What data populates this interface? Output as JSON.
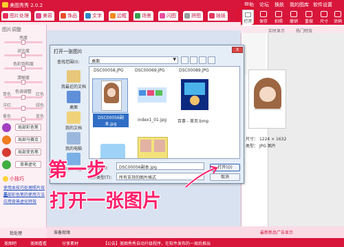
{
  "app": {
    "title": "美图秀秀 2.0.2"
  },
  "window_controls": {
    "items": [
      "帮助",
      "论坛",
      "换肤",
      "我的图库",
      "软件设置"
    ]
  },
  "tabs": [
    {
      "label": "图片处理",
      "color": "#e62e59"
    },
    {
      "label": "美容",
      "color": "#e24a86"
    },
    {
      "label": "饰品",
      "color": "#e64e2a"
    },
    {
      "label": "文字",
      "color": "#2e86c8"
    },
    {
      "label": "边框",
      "color": "#f28a1e"
    },
    {
      "label": "场景",
      "color": "#3aa04c"
    },
    {
      "label": "闪图",
      "color": "#e84e9e"
    },
    {
      "label": "拼图",
      "color": "#999999"
    },
    {
      "label": "娃娃",
      "color": "#e2365d"
    }
  ],
  "toolbar": {
    "open": "打开",
    "buttons": [
      "保存",
      "拍照",
      "撤销",
      "重做",
      "尺寸",
      "涂鸦"
    ]
  },
  "left_panel": {
    "section_title": "图片调整",
    "sliders": [
      {
        "label": "亮度",
        "value": 0.5
      },
      {
        "label": "对比度",
        "value": 0.5
      },
      {
        "label": "色彩饱和度",
        "value": 0.5
      },
      {
        "label": "清晰度",
        "value": 0.5
      }
    ],
    "color_section_title": "色调调整",
    "color_sliders": [
      {
        "left": "青色",
        "right": "红色",
        "value": 0.5
      },
      {
        "left": "洋红",
        "right": "绿色",
        "value": 0.5
      },
      {
        "left": "黄色",
        "right": "蓝色",
        "value": 0.5
      }
    ],
    "effects": [
      {
        "label": "局部彩色笔",
        "color": "#a13fbf"
      },
      {
        "label": "局部马赛克",
        "color": "#f07d21"
      },
      {
        "label": "局部变色笔",
        "color": "#d63b32"
      },
      {
        "label": "背景虚化",
        "color": "#3fae3f"
      }
    ],
    "tips_title": "小技巧",
    "tips": [
      "使用本技巧处理照片效果",
      "局部彩色笔的使用方法",
      "应用背景虚化特效"
    ],
    "footer": "批处理"
  },
  "right_panel": {
    "tabs": [
      "实时显示",
      "热门特效"
    ],
    "footer": "最新新品广告显示"
  },
  "dialog": {
    "title": "打开一张图片",
    "close": "X",
    "look_in_label": "查找范围(I):",
    "look_in_value": "桌面",
    "places": [
      "我最近的文档",
      "桌面",
      "我的文档",
      "我的电脑",
      "网上邻居"
    ],
    "files_top": [
      "DSC00058.JPG",
      "DSC00069.JPG",
      "DSC00089.JPG"
    ],
    "files": [
      {
        "name": "DSC00056副本.jpg",
        "selected": true
      },
      {
        "name": "index1_01.jpg"
      },
      {
        "name": "百事 - 首页.bmp"
      }
    ],
    "filename_label": "文件名(N):",
    "filename_value": "DSC00056副本.jpg",
    "filetype_label": "文件类型(T):",
    "filetype_value": "所有支持的图片格式",
    "open_button": "打开(O)",
    "cancel_button": "取消",
    "preview": {
      "size_label": "尺寸：",
      "size_value": "1224 × 1632",
      "type_label": "类型：",
      "type_value": "JPG 图片"
    }
  },
  "overlay": {
    "step": "第一步",
    "instruction": "打开一张图片"
  },
  "statusbar": {
    "items": [
      "美图吧",
      "美图看看",
      "分享素材"
    ],
    "notice": "【公告】美图秀秀自动升级程序，在软件发布的一周后推出"
  },
  "bottom_strip": {
    "label": "准备就绪"
  }
}
